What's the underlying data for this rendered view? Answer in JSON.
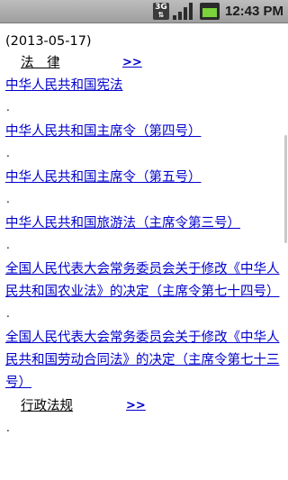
{
  "status_bar": {
    "network": "3G",
    "time": "12:43 PM",
    "battery_level": 0.8
  },
  "page": {
    "date": "(2013-05-17)",
    "sections": [
      {
        "title": "法　律",
        "more": ">>",
        "links": [
          "中华人民共和国宪法",
          "中华人民共和国主席令（第四号）",
          "中华人民共和国主席令（第五号）",
          "中华人民共和国旅游法（主席令第三号）",
          "全国人民代表大会常务委员会关于修改《中华人民共和国农业法》的决定（主席令第七十四号）",
          "全国人民代表大会常务委员会关于修改《中华人民共和国劳动合同法》的决定（主席令第七十三号）"
        ]
      },
      {
        "title": "行政法规",
        "more": ">>",
        "links": []
      }
    ]
  }
}
